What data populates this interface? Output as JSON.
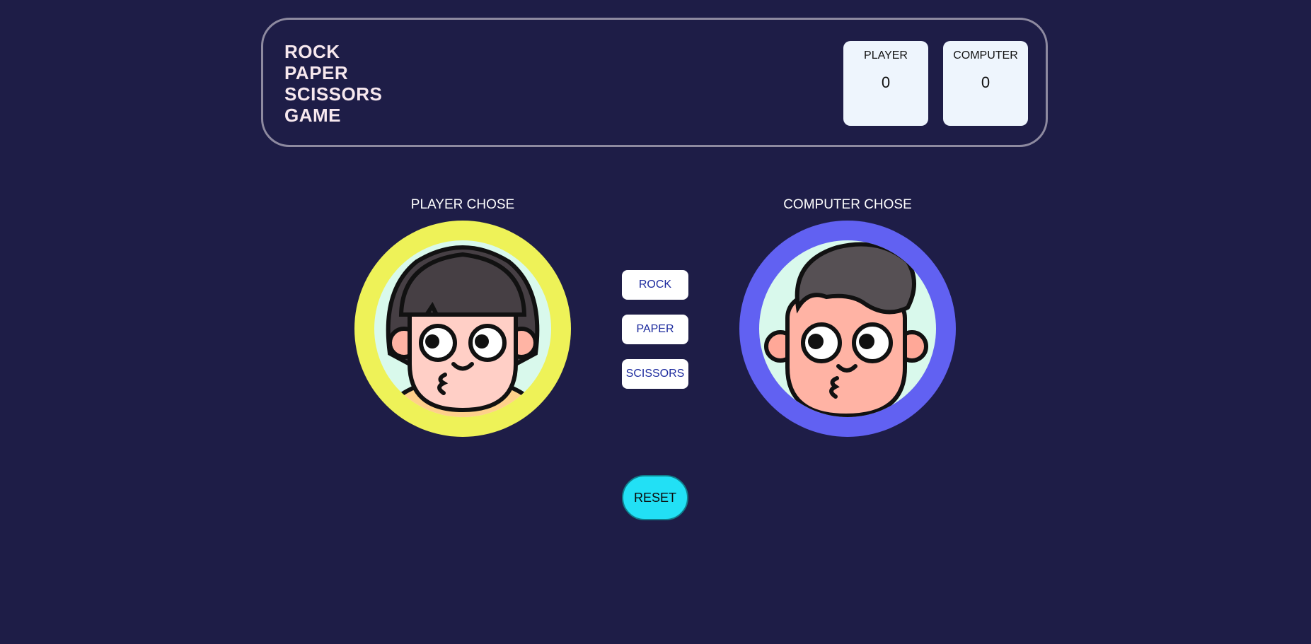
{
  "title": {
    "line1": "ROCK",
    "line2": "PAPER",
    "line3": "SCISSORS",
    "line4": "GAME"
  },
  "scoreboard": {
    "player_label": "PLAYER",
    "player_score": "0",
    "computer_label": "COMPUTER",
    "computer_score": "0"
  },
  "arena": {
    "player_chose_label": "PLAYER CHOSE",
    "computer_chose_label": "COMPUTER CHOSE",
    "player_avatar_icon": "girl-avatar-icon",
    "computer_avatar_icon": "boy-avatar-icon"
  },
  "choices": {
    "rock_label": "ROCK",
    "paper_label": "PAPER",
    "scissors_label": "SCISSORS"
  },
  "controls": {
    "reset_label": "RESET"
  },
  "colors": {
    "background": "#1e1d47",
    "player_ring": "#eef258",
    "computer_ring": "#6161f2",
    "reset_button": "#22e0f5"
  }
}
